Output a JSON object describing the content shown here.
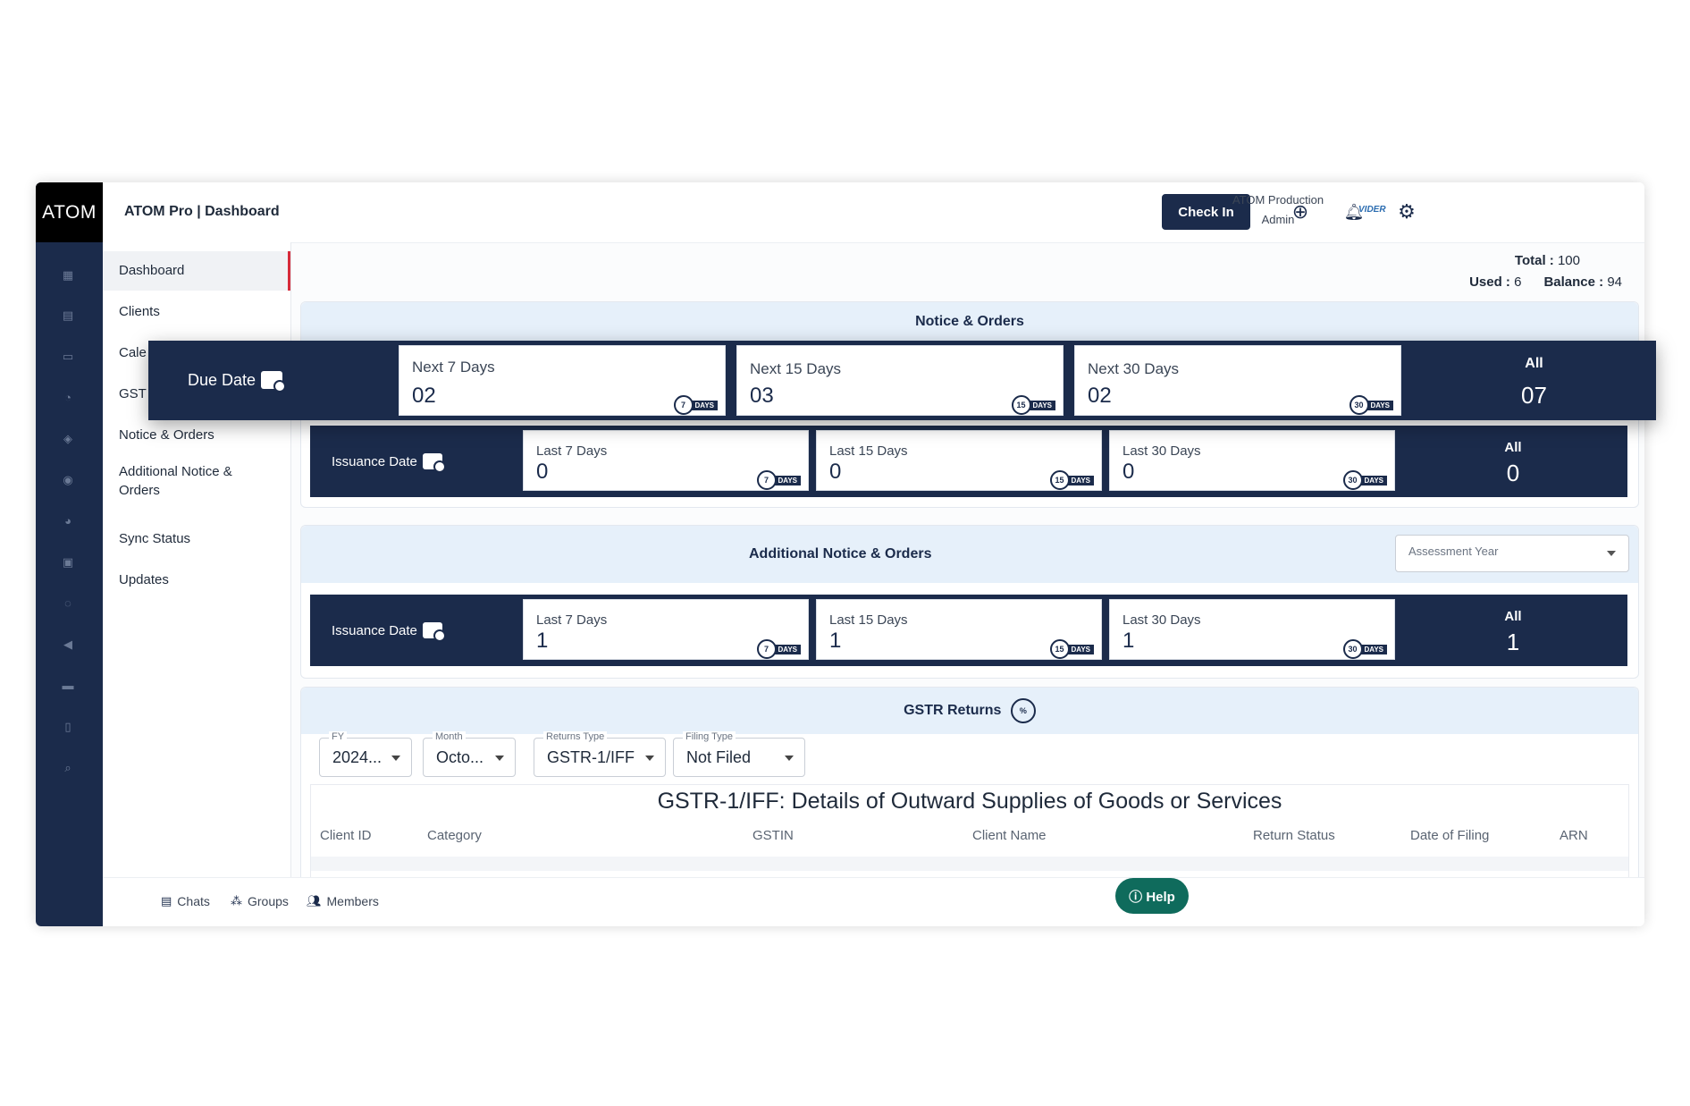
{
  "app": {
    "logo": "ATOM",
    "breadcrumb": "ATOM Pro | Dashboard"
  },
  "header": {
    "check_in_label": "Check In",
    "user_name": "ATOM Production",
    "user_role": "Admin",
    "brand": "VIDER",
    "icons": [
      "add-circle-icon",
      "bell-icon",
      "gear-icon"
    ]
  },
  "sidebar": {
    "items": [
      {
        "label": "Dashboard",
        "active": true
      },
      {
        "label": "Clients"
      },
      {
        "label": "Cale"
      },
      {
        "label": "GST"
      },
      {
        "label": "Notice & Orders"
      },
      {
        "label": "Additional Notice & Orders"
      },
      {
        "label": "Sync Status"
      },
      {
        "label": "Updates"
      }
    ]
  },
  "totals": {
    "total_label": "Total :",
    "total_value": "100",
    "used_label": "Used :",
    "used_value": "6",
    "balance_label": "Balance :",
    "balance_value": "94"
  },
  "notice_orders": {
    "title": "Notice & Orders",
    "due_date": {
      "label": "Due Date",
      "cards": [
        {
          "label": "Next 7 Days",
          "value": "02",
          "badge": "7"
        },
        {
          "label": "Next 15 Days",
          "value": "03",
          "badge": "15"
        },
        {
          "label": "Next 30 Days",
          "value": "02",
          "badge": "30"
        }
      ],
      "all_label": "All",
      "all_value": "07"
    },
    "issuance_date": {
      "label": "Issuance Date",
      "cards": [
        {
          "label": "Last 7 Days",
          "value": "0",
          "badge": "7"
        },
        {
          "label": "Last 15 Days",
          "value": "0",
          "badge": "15"
        },
        {
          "label": "Last 30 Days",
          "value": "0",
          "badge": "30"
        }
      ],
      "all_label": "All",
      "all_value": "0"
    }
  },
  "additional_notice": {
    "title": "Additional Notice & Orders",
    "assessment_year_placeholder": "Assessment Year",
    "issuance_date": {
      "label": "Issuance Date",
      "cards": [
        {
          "label": "Last 7 Days",
          "value": "1",
          "badge": "7"
        },
        {
          "label": "Last 15 Days",
          "value": "1",
          "badge": "15"
        },
        {
          "label": "Last 30 Days",
          "value": "1",
          "badge": "30"
        }
      ],
      "all_label": "All",
      "all_value": "1"
    }
  },
  "days_tag": "DAYS",
  "gstr": {
    "title": "GSTR Returns",
    "filters": [
      {
        "label": "FY",
        "value": "2024..."
      },
      {
        "label": "Month",
        "value": "Octo..."
      },
      {
        "label": "Returns Type",
        "value": "GSTR-1/IFF"
      },
      {
        "label": "Filing Type",
        "value": "Not Filed"
      }
    ],
    "table_title": "GSTR-1/IFF: Details of Outward Supplies of Goods or Services",
    "columns": [
      "Client ID",
      "Category",
      "GSTIN",
      "Client Name",
      "Return Status",
      "Date of Filing",
      "ARN"
    ]
  },
  "footer": {
    "chats": "Chats",
    "groups": "Groups",
    "members": "Members",
    "help": "Help"
  }
}
